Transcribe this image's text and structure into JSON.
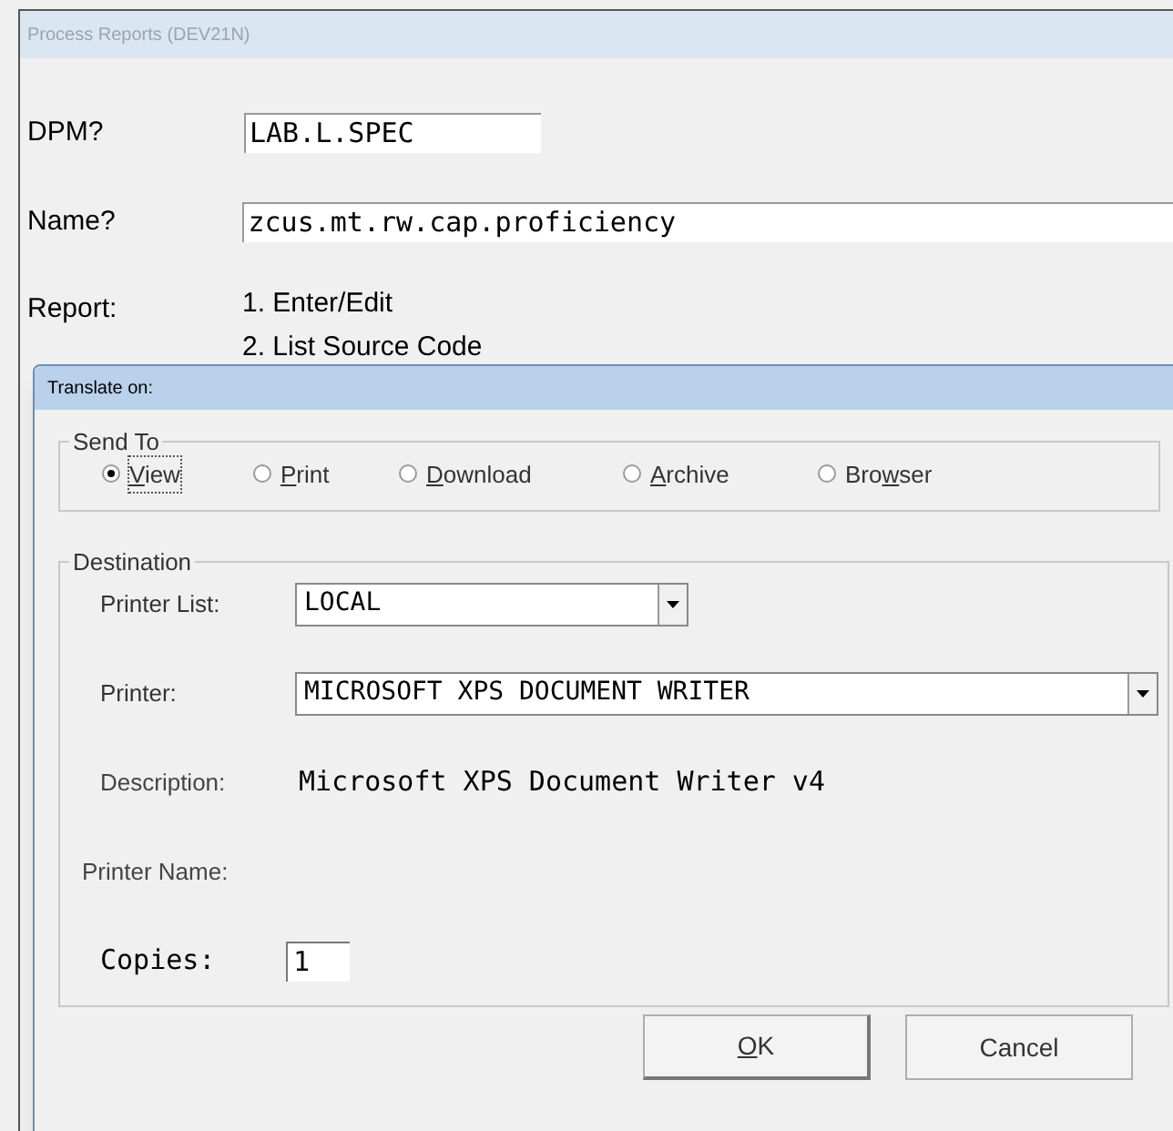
{
  "window": {
    "title": "Process Reports (DEV21N)"
  },
  "fields": [
    {
      "label": "DPM?",
      "value": "LAB.L.SPEC"
    },
    {
      "label": "Name?",
      "value": "zcus.mt.rw.cap.proficiency"
    }
  ],
  "report": {
    "label": "Report:",
    "options": [
      "1. Enter/Edit",
      "2. List Source Code"
    ]
  },
  "dialog": {
    "title": "Translate on:",
    "send_to": {
      "legend": "Send To",
      "options": [
        {
          "key": "V",
          "post": "iew",
          "selected": true
        },
        {
          "key": "P",
          "post": "rint",
          "selected": false
        },
        {
          "key": "D",
          "post": "ownload",
          "selected": false
        },
        {
          "key": "A",
          "post": "rchive",
          "selected": false
        },
        {
          "pre": "Bro",
          "key": "w",
          "post": "ser",
          "selected": false
        }
      ]
    },
    "destination": {
      "legend": "Destination",
      "printer_list": {
        "label": "Printer List:",
        "value": "LOCAL"
      },
      "printer": {
        "label": "Printer:",
        "value": "MICROSOFT XPS DOCUMENT WRITER"
      },
      "description": {
        "label": "Description:",
        "value": "Microsoft XPS Document Writer v4"
      },
      "printer_name": {
        "label": "Printer Name:"
      },
      "copies": {
        "label": "Copies:",
        "value": "1"
      }
    },
    "buttons": [
      {
        "key": "O",
        "post": "K"
      },
      {
        "pre": "Cancel"
      }
    ]
  }
}
